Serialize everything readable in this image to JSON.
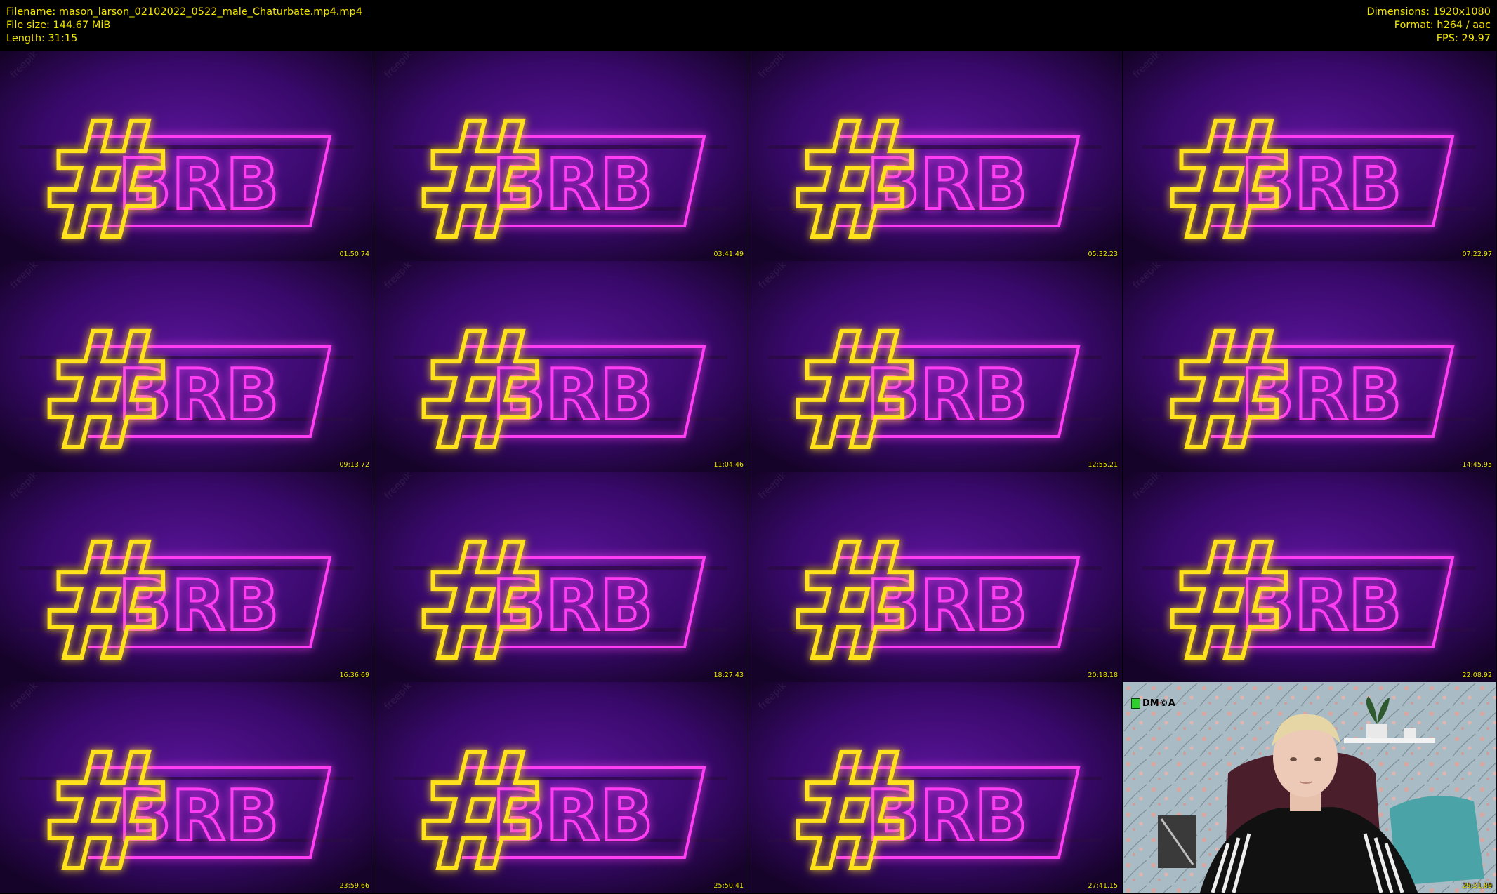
{
  "header": {
    "filename_line": "Filename: mason_larson_02102022_0522_male_Chaturbate.mp4.mp4",
    "filesize_line": "File size: 144.67 MiB",
    "length_line": "Length: 31:15",
    "dimensions_line": "Dimensions: 1920x1080",
    "format_line": "Format: h264 / aac",
    "fps_line": "FPS: 29.97"
  },
  "sign": {
    "hash": "#",
    "text": "BRB",
    "hash_color": "#ffe21a",
    "text_color": "#ff3cf2"
  },
  "watermark": "freepik",
  "dmca_label": "DM©A",
  "thumbnails": [
    {
      "time": "01:50.74"
    },
    {
      "time": "03:41.49"
    },
    {
      "time": "05:32.23"
    },
    {
      "time": "07:22.97"
    },
    {
      "time": "09:13.72"
    },
    {
      "time": "11:04.46"
    },
    {
      "time": "12:55.21"
    },
    {
      "time": "14:45.95"
    },
    {
      "time": "16:36.69"
    },
    {
      "time": "18:27.43"
    },
    {
      "time": "20:18.18"
    },
    {
      "time": "22:08.92"
    },
    {
      "time": "23:59.66"
    },
    {
      "time": "25:50.41"
    },
    {
      "time": "27:41.15"
    },
    {
      "time": "29:31.89"
    }
  ]
}
